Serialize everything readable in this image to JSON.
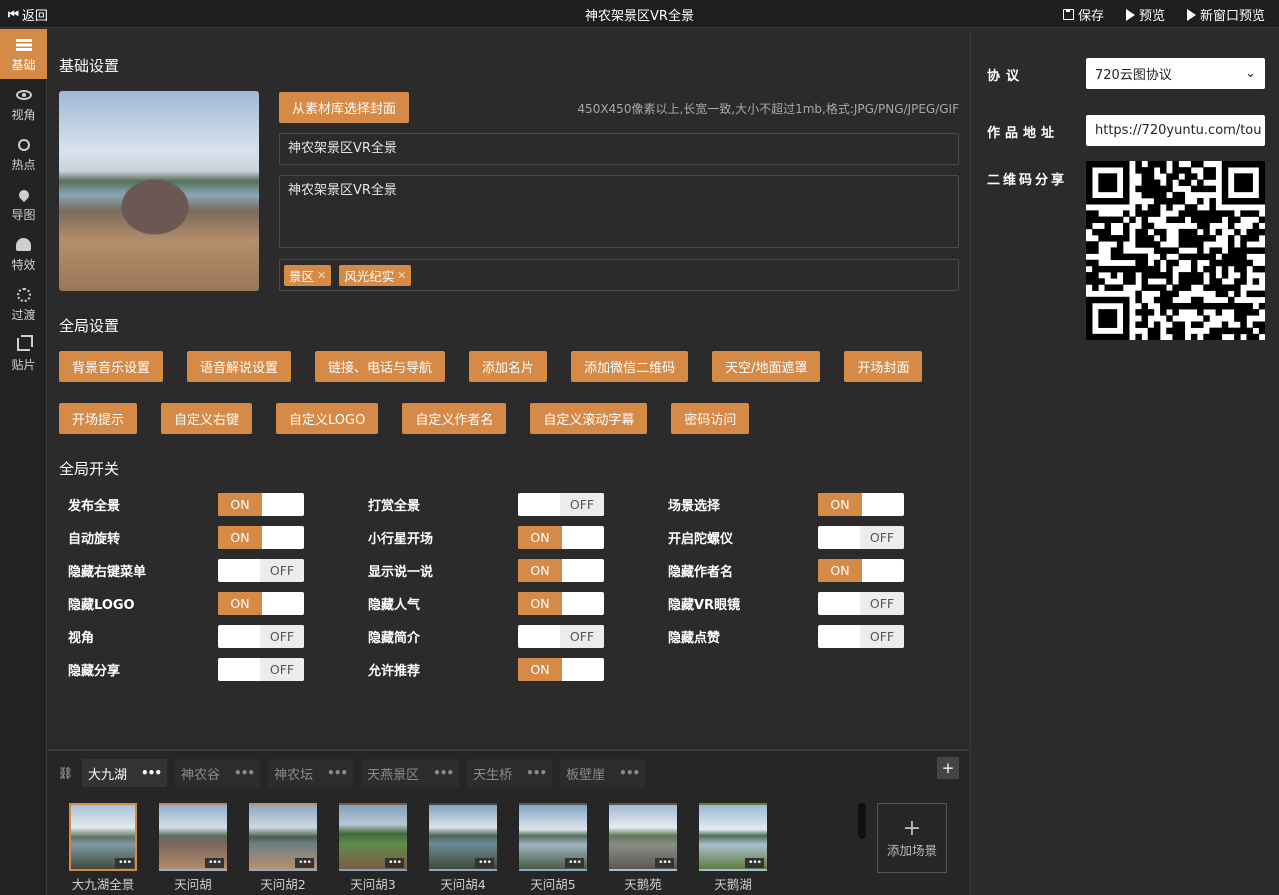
{
  "topbar": {
    "back_label": "返回",
    "title": "神农架景区VR全景",
    "save_label": "保存",
    "preview_label": "预览",
    "new_window_preview_label": "新窗口预览"
  },
  "sidebar": {
    "items": [
      {
        "label": "基础",
        "icon": "list-icon",
        "active": true
      },
      {
        "label": "视角",
        "icon": "eye-icon"
      },
      {
        "label": "热点",
        "icon": "ring-icon"
      },
      {
        "label": "导图",
        "icon": "map-pin-icon"
      },
      {
        "label": "特效",
        "icon": "gauge-icon"
      },
      {
        "label": "过渡",
        "icon": "spinner-icon"
      },
      {
        "label": "贴片",
        "icon": "crop-icon"
      }
    ]
  },
  "basic": {
    "section_title": "基础设置",
    "pick_cover_label": "从素材库选择封面",
    "cover_hint": "450X450像素以上,长宽一致,大小不超过1mb,格式:JPG/PNG/JPEG/GIF",
    "title_value": "神农架景区VR全景",
    "description_value": "神农架景区VR全景",
    "tags": [
      "景区",
      "风光纪实"
    ]
  },
  "global": {
    "section_title": "全局设置",
    "row1": [
      "背景音乐设置",
      "语音解说设置",
      "链接、电话与导航",
      "添加名片",
      "添加微信二维码",
      "天空/地面遮罩",
      "开场封面"
    ],
    "row2": [
      "开场提示",
      "自定义右键",
      "自定义LOGO",
      "自定义作者名",
      "自定义滚动字幕",
      "密码访问"
    ]
  },
  "switches": {
    "section_title": "全局开关",
    "on_text": "ON",
    "off_text": "OFF",
    "rows": [
      [
        {
          "label": "发布全景",
          "on": true
        },
        {
          "label": "打赏全景",
          "on": false
        },
        {
          "label": "场景选择",
          "on": true
        }
      ],
      [
        {
          "label": "自动旋转",
          "on": true
        },
        {
          "label": "小行星开场",
          "on": true
        },
        {
          "label": "开启陀螺仪",
          "on": false
        }
      ],
      [
        {
          "label": "隐藏右键菜单",
          "on": false
        },
        {
          "label": "显示说一说",
          "on": true
        },
        {
          "label": "隐藏作者名",
          "on": true
        }
      ],
      [
        {
          "label": "隐藏LOGO",
          "on": true
        },
        {
          "label": "隐藏人气",
          "on": true
        },
        {
          "label": "隐藏VR眼镜",
          "on": false
        }
      ],
      [
        {
          "label": "视角",
          "on": false
        },
        {
          "label": "隐藏简介",
          "on": false
        },
        {
          "label": "隐藏点赞",
          "on": false
        }
      ],
      [
        {
          "label": "隐藏分享",
          "on": false
        },
        {
          "label": "允许推荐",
          "on": true
        }
      ]
    ]
  },
  "scenes": {
    "groups": [
      {
        "label": "大九湖",
        "active": true
      },
      {
        "label": "神农谷"
      },
      {
        "label": "神农坛"
      },
      {
        "label": "天燕景区"
      },
      {
        "label": "天生桥"
      },
      {
        "label": "板壁崖"
      }
    ],
    "more_glyph": "•••",
    "add_group_glyph": "+",
    "thumbs": [
      {
        "label": "大九湖全景",
        "active": true
      },
      {
        "label": "天问胡"
      },
      {
        "label": "天问胡2"
      },
      {
        "label": "天问胡3"
      },
      {
        "label": "天问胡4"
      },
      {
        "label": "天问胡5"
      },
      {
        "label": "天鹅苑"
      },
      {
        "label": "天鹅湖"
      }
    ],
    "add_scene_plus": "+",
    "add_scene_label": "添加场景"
  },
  "right_panel": {
    "protocol_label": "协议",
    "protocol_value": "720云图协议",
    "url_label": "作品地址",
    "url_value": "https://720yuntu.com/tou",
    "qr_label": "二维码分享"
  },
  "colors": {
    "accent": "#d58a47",
    "background": "#2b2b2b",
    "topbar": "#1e1e1e"
  }
}
